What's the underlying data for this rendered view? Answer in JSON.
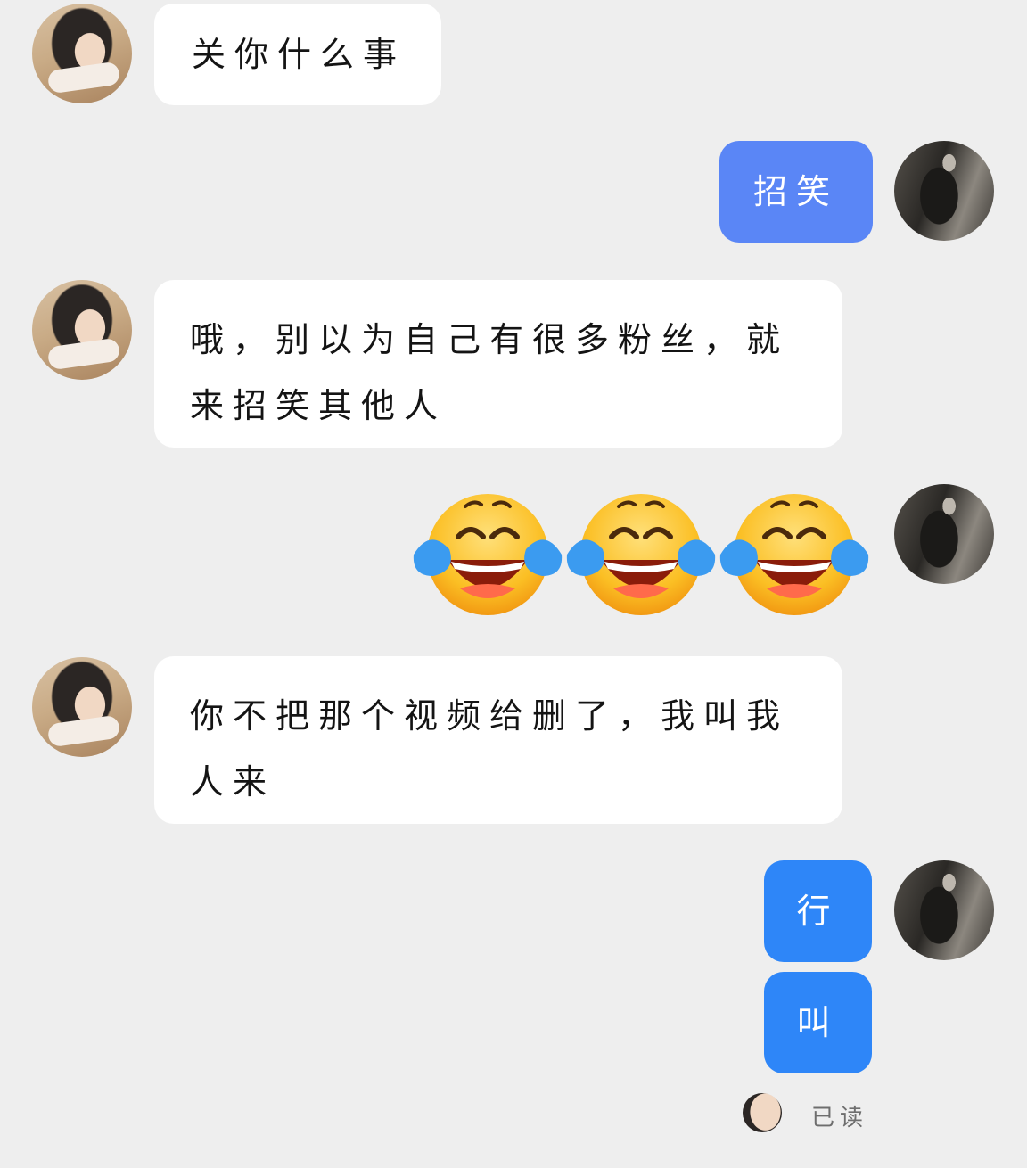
{
  "contact": {
    "avatar_icon": "avatar-photo-girl"
  },
  "me": {
    "avatar_icon": "avatar-photo-dark"
  },
  "messages": [
    {
      "from": "them",
      "text": "关你什么事"
    },
    {
      "from": "me",
      "text": "招笑"
    },
    {
      "from": "them",
      "text": "哦，别以为自己有很多粉丝，就来招笑其他人"
    },
    {
      "from": "me",
      "emoji": [
        "😂",
        "😂",
        "😂"
      ],
      "emoji_icon": "face-with-tears-of-joy-icon"
    },
    {
      "from": "them",
      "text": "你不把那个视频给删了，我叫我人来"
    },
    {
      "from": "me",
      "text": "行"
    },
    {
      "from": "me",
      "text": "叫"
    }
  ],
  "read_receipt": {
    "text": "已读"
  },
  "colors": {
    "background": "#eeeeee",
    "incoming_bubble": "#ffffff",
    "outgoing_bubble": "#2e86f8",
    "outgoing_bubble_alt": "#5a86f6",
    "text_dark": "#141414",
    "read_text": "#6e6e6e"
  }
}
